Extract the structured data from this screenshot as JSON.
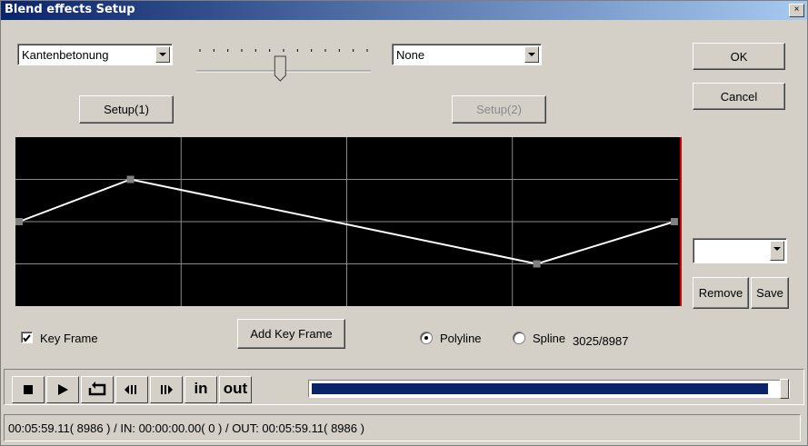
{
  "window": {
    "title": "Blend effects Setup",
    "close_glyph": "×"
  },
  "effect1": {
    "selected": "Kantenbetonung",
    "setup_label": "Setup(1)"
  },
  "effect2": {
    "selected": "None",
    "setup_label": "Setup(2)"
  },
  "slider": {
    "value_fraction": 0.48,
    "tick_count": 13
  },
  "buttons": {
    "ok": "OK",
    "cancel": "Cancel",
    "remove": "Remove",
    "save": "Save",
    "add_key_frame": "Add Key Frame"
  },
  "keyframe_combo": {
    "selected": ""
  },
  "keyframe_checkbox": {
    "label": "Key Frame",
    "checked": true
  },
  "curve_mode": {
    "polyline_label": "Polyline",
    "spline_label": "Spline",
    "selected": "Polyline",
    "position": "3025/8987"
  },
  "curve": {
    "colors": {
      "background": "#000000",
      "grid": "#8a8a8a",
      "line": "#ffffff",
      "marker": "#808080",
      "cursor": "#cc0000"
    },
    "points": [
      {
        "t": 0.0,
        "level": 0.5
      },
      {
        "t": 0.17,
        "level": 0.75
      },
      {
        "t": 0.79,
        "level": 0.25
      },
      {
        "t": 1.0,
        "level": 0.5
      }
    ]
  },
  "transport": {
    "stop_icon": "stop-icon",
    "play_icon": "play-icon",
    "loop_icon": "loop-icon",
    "prev_icon": "step-back-icon",
    "next_icon": "step-forward-icon",
    "in_label": "in",
    "out_label": "out",
    "progress": 0.985
  },
  "status": {
    "text": "00:05:59.11( 8986 ) / IN: 00:00:00.00( 0 ) / OUT: 00:05:59.11( 8986 )"
  }
}
